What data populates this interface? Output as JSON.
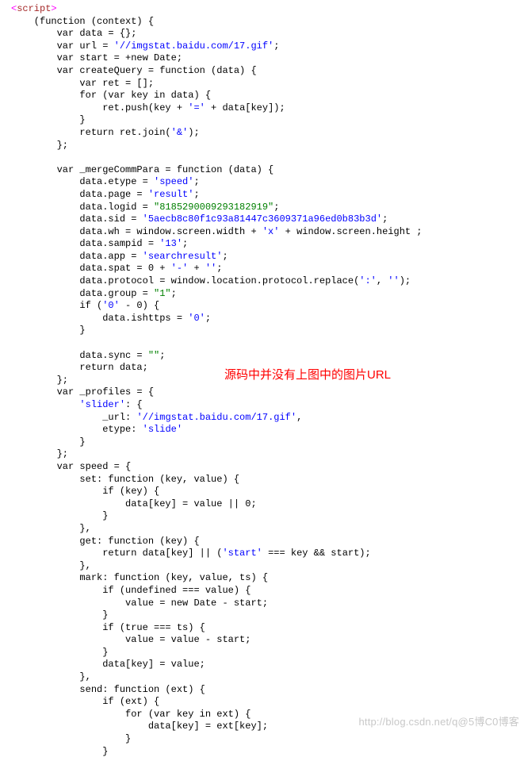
{
  "annotation": "源码中并没有上图中的图片URL",
  "watermark": "http://blog.csdn.net/q@5博C0博客",
  "code": {
    "open_tag_l": "<",
    "open_tag_name": "script",
    "open_tag_r": ">",
    "line_fn_open": "    (function (context) {",
    "line_data": "        var data = {};",
    "line_url_a": "        var url = ",
    "line_url_s": "'//imgstat.baidu.com/17.gif'",
    "line_url_b": ";",
    "line_start": "        var start = +new Date;",
    "line_cq": "        var createQuery = function (data) {",
    "line_ret": "            var ret = [];",
    "line_for": "            for (var key in data) {",
    "line_push_a": "                ret.push(key + ",
    "line_push_s": "'='",
    "line_push_b": " + data[key]);",
    "line_cb1": "            }",
    "line_join_a": "            return ret.join(",
    "line_join_s": "'&'",
    "line_join_b": ");",
    "line_cb2": "        };",
    "line_blank": "",
    "line_merge": "        var _mergeCommPara = function (data) {",
    "line_etype_a": "            data.etype = ",
    "line_etype_s": "'speed'",
    "line_sc": ";",
    "line_page_a": "            data.page = ",
    "line_page_s": "'result'",
    "line_logid_a": "            data.logid = ",
    "line_logid_s": "\"8185290009293182919\"",
    "line_sid_a": "            data.sid = ",
    "line_sid_s": "'5aecb8c80f1c93a81447c3609371a96ed0b83b3d'",
    "line_wh_a": "            data.wh = window.screen.width + ",
    "line_wh_s": "'x'",
    "line_wh_b": " + window.screen.height ;",
    "line_samp_a": "            data.sampid = ",
    "line_samp_s": "'13'",
    "line_app_a": "            data.app = ",
    "line_app_s": "'searchresult'",
    "line_spat_a": "            data.spat = 0 + ",
    "line_spat_s1": "'-'",
    "line_spat_m": " + ",
    "line_spat_s2": "''",
    "line_proto_a": "            data.protocol = window.location.protocol.replace(",
    "line_proto_s1": "':'",
    "line_proto_m": ", ",
    "line_proto_s2": "''",
    "line_proto_b": ");",
    "line_group_a": "            data.group = ",
    "line_group_s": "\"1\"",
    "line_if0_a": "            if (",
    "line_if0_s": "'0'",
    "line_if0_b": " - 0) {",
    "line_ishttps_a": "                data.ishttps = ",
    "line_ishttps_s": "'0'",
    "line_cb3": "            }",
    "line_sync_a": "            data.sync = ",
    "line_sync_s": "\"\"",
    "line_retdata": "            return data;",
    "line_cb4": "        };",
    "line_profiles": "        var _profiles = {",
    "line_slider_a": "            ",
    "line_slider_s": "'slider'",
    "line_slider_b": ": {",
    "line_purl_a": "                _url: ",
    "line_purl_s": "'//imgstat.baidu.com/17.gif'",
    "line_purl_b": ",",
    "line_petype_a": "                etype: ",
    "line_petype_s": "'slide'",
    "line_cb5": "            }",
    "line_cb6": "        };",
    "line_speed": "        var speed = {",
    "line_set": "            set: function (key, value) {",
    "line_ifkey": "                if (key) {",
    "line_dkv": "                    data[key] = value || 0;",
    "line_cb7": "                }",
    "line_comma": "            },",
    "line_get": "            get: function (key) {",
    "line_getret_a": "                return data[key] || (",
    "line_getret_s": "'start'",
    "line_getret_b": " === key && start);",
    "line_mark": "            mark: function (key, value, ts) {",
    "line_ifundef": "                if (undefined === value) {",
    "line_valnew": "                    value = new Date - start;",
    "line_ifts": "                if (true === ts) {",
    "line_valts": "                    value = value - start;",
    "line_dkval": "                data[key] = value;",
    "line_send": "            send: function (ext) {",
    "line_ifext": "                if (ext) {",
    "line_forext": "                    for (var key in ext) {",
    "line_dkext": "                        data[key] = ext[key];",
    "line_cb8": "                    }",
    "line_cb9": "                }"
  }
}
